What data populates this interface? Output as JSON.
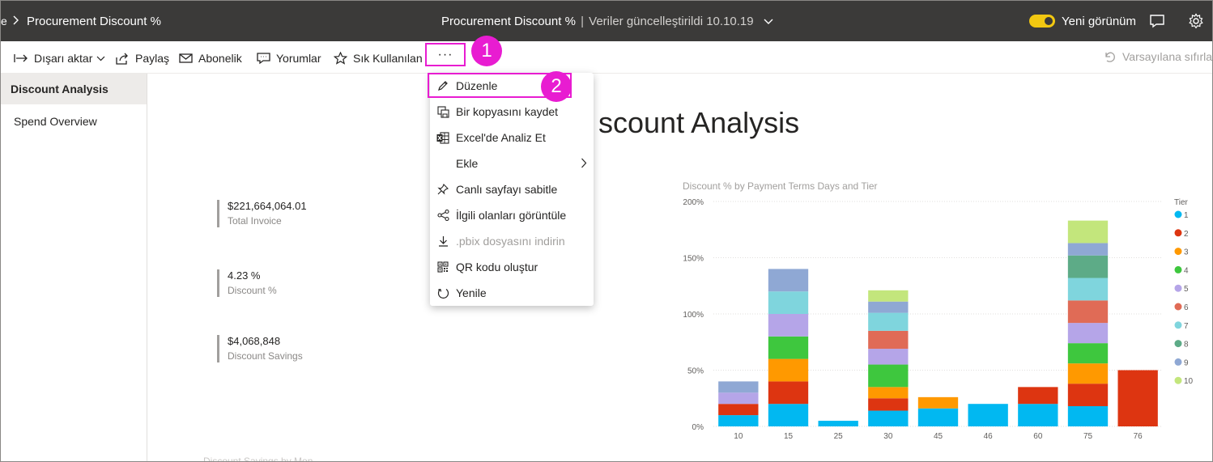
{
  "topbar": {
    "cut_text": "e",
    "breadcrumb": "Procurement Discount %",
    "report_title": "Procurement Discount %",
    "separator": "|",
    "updated_text": "Veriler güncelleştirildi 10.10.19",
    "toggle_label": "Yeni görünüm",
    "icons": [
      "chevron-right-icon",
      "chevron-down-icon",
      "comment-icon",
      "gear-icon"
    ]
  },
  "actionbar": {
    "export": "Dışarı aktar",
    "share": "Paylaş",
    "subscribe": "Abonelik",
    "comments": "Yorumlar",
    "favorite": "Sık Kullanılan",
    "more": "···",
    "reset": "Varsayılana sıfırla"
  },
  "callouts": {
    "one": "1",
    "two": "2"
  },
  "pages": {
    "items": [
      "Discount Analysis",
      "Spend Overview"
    ],
    "active_index": 0
  },
  "menu": {
    "items": [
      {
        "label": "Düzenle",
        "icon": "pencil-icon",
        "disabled": false
      },
      {
        "label": "Bir kopyasını kaydet",
        "icon": "save-copy-icon",
        "disabled": false
      },
      {
        "label": "Excel'de Analiz Et",
        "icon": "excel-icon",
        "disabled": false
      },
      {
        "label": "Ekle",
        "icon": "",
        "disabled": false,
        "submenu": true
      },
      {
        "label": "Canlı sayfayı sabitle",
        "icon": "pin-icon",
        "disabled": false
      },
      {
        "label": "İlgili olanları görüntüle",
        "icon": "share-nodes-icon",
        "disabled": false
      },
      {
        "label": ".pbix dosyasını indirin",
        "icon": "download-icon",
        "disabled": true
      },
      {
        "label": "QR kodu oluştur",
        "icon": "qr-code-icon",
        "disabled": false
      },
      {
        "label": "Yenile",
        "icon": "refresh-icon",
        "disabled": false
      }
    ]
  },
  "report": {
    "title_visible": "scount Analysis",
    "cards": [
      {
        "value": "$221,664,064.01",
        "label": "Total Invoice"
      },
      {
        "value": "4.23 %",
        "label": "Discount %"
      },
      {
        "value": "$4,068,848",
        "label": "Discount Savings"
      }
    ],
    "bottom_visual_title": "Discount Savings by Mon"
  },
  "colors": {
    "accent_highlight": "#e81cd1",
    "topbar_bg": "#3b3a39",
    "toggle": "#f2c811"
  },
  "chart_data": {
    "type": "bar",
    "stacked": true,
    "title": "Discount % by Payment Terms Days and Tier",
    "legend_title": "Tier",
    "legend_position": "right",
    "xlabel": "",
    "ylabel": "",
    "ylim": [
      0,
      200
    ],
    "y_ticks": [
      "0%",
      "50%",
      "100%",
      "150%",
      "200%"
    ],
    "grid": true,
    "categories": [
      "10",
      "15",
      "25",
      "30",
      "45",
      "46",
      "60",
      "75",
      "76"
    ],
    "series": [
      {
        "name": "1",
        "color": "#01b8f1",
        "values": [
          10,
          20,
          5,
          14,
          16,
          20,
          20,
          18,
          0
        ]
      },
      {
        "name": "2",
        "color": "#dd3511",
        "values": [
          10,
          20,
          0,
          11,
          0,
          0,
          15,
          20,
          50
        ]
      },
      {
        "name": "3",
        "color": "#ff9900",
        "values": [
          0,
          20,
          0,
          10,
          10,
          0,
          0,
          18,
          0
        ]
      },
      {
        "name": "4",
        "color": "#3ec73e",
        "values": [
          0,
          20,
          0,
          20,
          0,
          0,
          0,
          18,
          0
        ]
      },
      {
        "name": "5",
        "color": "#b5a5e8",
        "values": [
          10,
          20,
          0,
          14,
          0,
          0,
          0,
          18,
          0
        ]
      },
      {
        "name": "6",
        "color": "#e06b56",
        "values": [
          0,
          0,
          0,
          16,
          0,
          0,
          0,
          20,
          0
        ]
      },
      {
        "name": "7",
        "color": "#7fd5dd",
        "values": [
          0,
          20,
          0,
          16,
          0,
          0,
          0,
          20,
          0
        ]
      },
      {
        "name": "8",
        "color": "#5dab87",
        "values": [
          0,
          0,
          0,
          0,
          0,
          0,
          0,
          20,
          0
        ]
      },
      {
        "name": "9",
        "color": "#8fa8d4",
        "values": [
          10,
          20,
          0,
          10,
          0,
          0,
          0,
          11,
          0
        ]
      },
      {
        "name": "10",
        "color": "#c3e67c",
        "values": [
          0,
          0,
          0,
          10,
          0,
          0,
          0,
          20,
          0
        ]
      }
    ]
  }
}
